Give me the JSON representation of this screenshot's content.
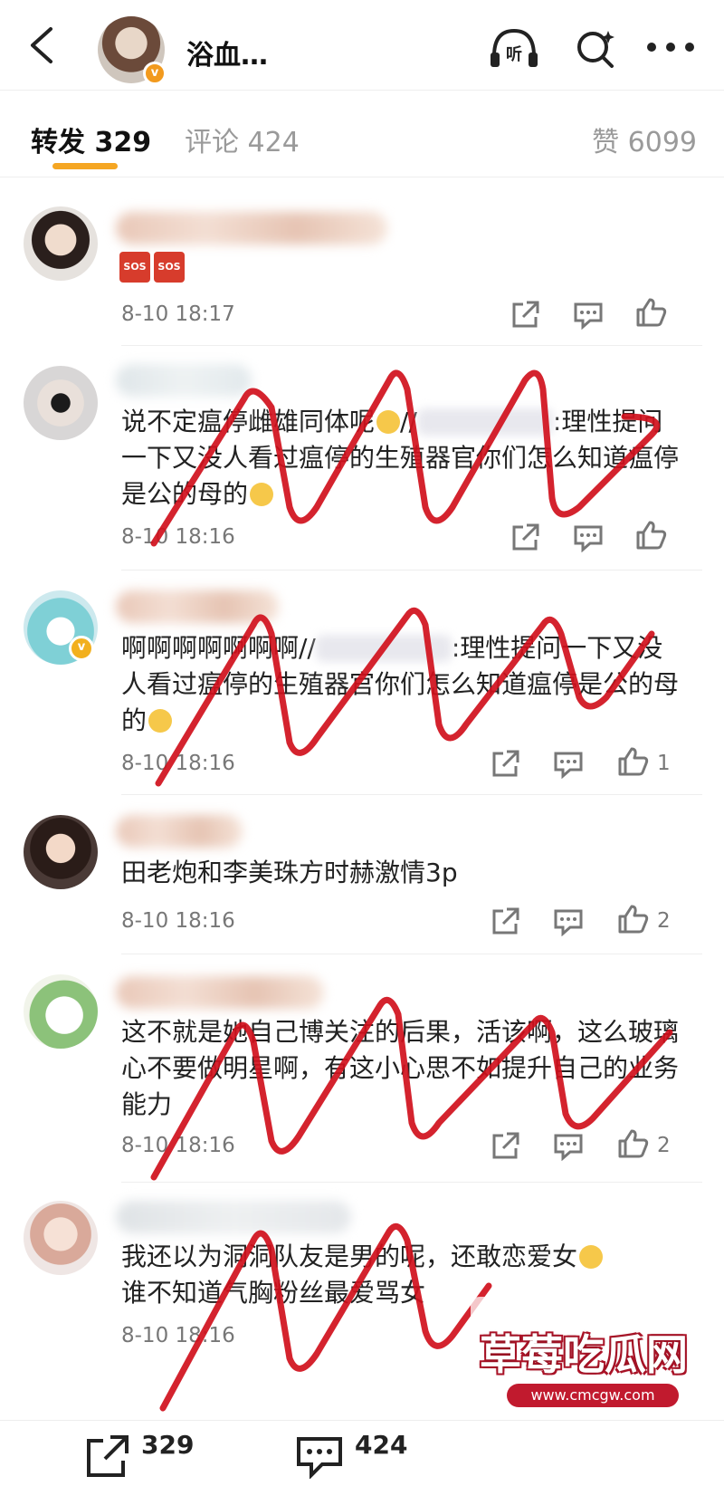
{
  "header": {
    "title": "浴血…",
    "badge_icon": "verified-badge-icon"
  },
  "tabs": {
    "forward": "转发 329",
    "comment": "评论 424",
    "like": "赞 6099"
  },
  "comments": [
    {
      "sos": [
        "SOS",
        "SOS"
      ],
      "time": "8-10 18:17",
      "likes": ""
    },
    {
      "text_a": "说不定瘟停雌雄同体呢",
      "text_b": "//",
      "text_c": ":理性提问一下又没人看过瘟停的生殖器官你们怎么知道瘟停是公的母的",
      "time": "8-10 18:16",
      "likes": ""
    },
    {
      "text_a": "啊啊啊啊啊啊啊//",
      "text_c": ":理性提问一下又没人看过瘟停的生殖器官你们怎么知道瘟停是公的母的",
      "time": "8-10 18:16",
      "likes": "1"
    },
    {
      "text": "田老炮和李美珠方时赫激情3p",
      "time": "8-10 18:16",
      "likes": "2"
    },
    {
      "text": "这不就是她自己博关注的后果，活该啊，这么玻璃心不要做明星啊，有这小心思不如提升自己的业务能力",
      "time": "8-10 18:16",
      "likes": "2"
    },
    {
      "text_a": "我还以为洞洞队友是男的呢，还敢恋爱女",
      "text_b": "谁不知道气胸粉丝最爱骂女",
      "time": "8-10 18:16",
      "likes": ""
    }
  ],
  "bottom": {
    "forward_count": "329",
    "comment_count": "424"
  },
  "watermark": {
    "title": "草莓吃瓜网",
    "url": "www.cmcgw.com"
  },
  "colors": {
    "accent": "#f5a623",
    "scribble": "#d0101c",
    "meta": "#777777"
  }
}
